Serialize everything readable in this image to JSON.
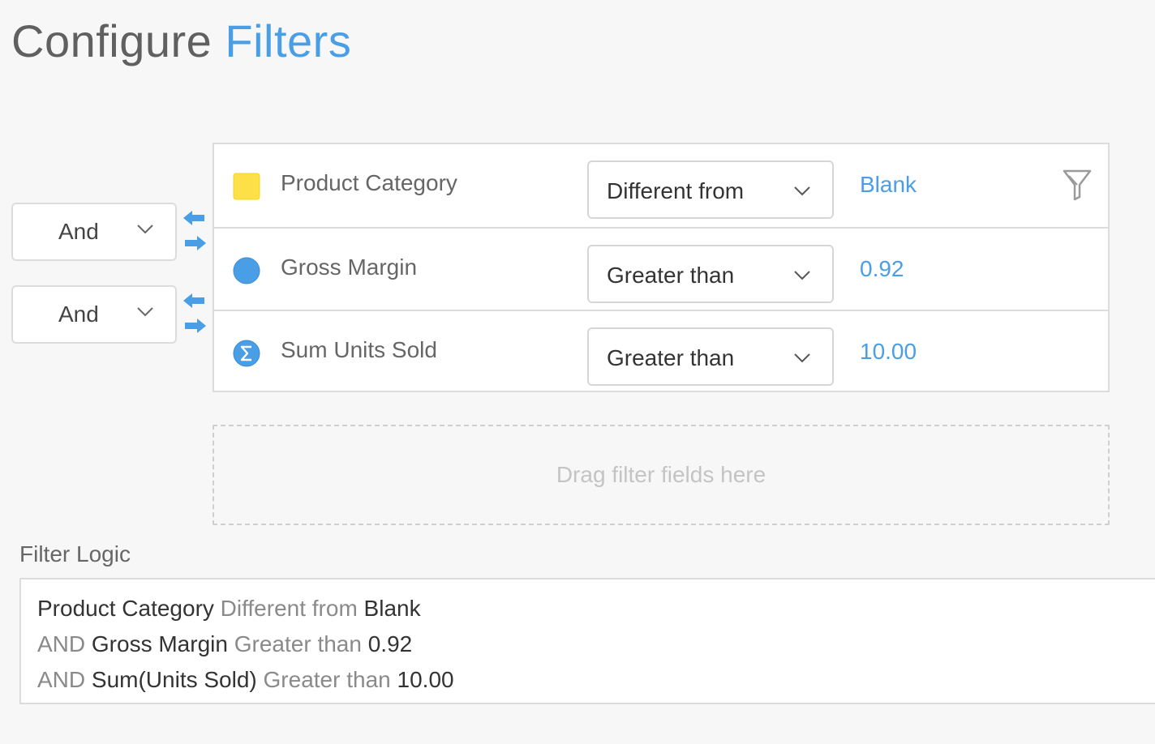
{
  "page": {
    "title_main": "Configure",
    "title_accent": "Filters",
    "accent_color": "#4a9ee6"
  },
  "connectors": [
    {
      "label": "And",
      "icon": "chevron-down-icon"
    },
    {
      "label": "And",
      "icon": "chevron-down-icon"
    }
  ],
  "filters": [
    {
      "field": "Product Category",
      "icon": "dimension-square-icon",
      "icon_color": "#fde047",
      "operator": "Different from",
      "value": "Blank"
    },
    {
      "field": "Gross Margin",
      "icon": "measure-circle-icon",
      "icon_color": "#4a9ee6",
      "operator": "Greater than",
      "value": "0.92"
    },
    {
      "field": "Sum Units Sold",
      "icon": "sigma-circle-icon",
      "icon_color": "#4a9ee6",
      "operator": "Greater than",
      "value": "10.00"
    }
  ],
  "drop_zone": {
    "text": "Drag filter fields here"
  },
  "filter_logic": {
    "label": "Filter Logic",
    "lines": [
      {
        "prefix": "",
        "field": "Product Category",
        "op": "Different from",
        "value": "Blank"
      },
      {
        "prefix": "AND",
        "field": "Gross Margin",
        "op": "Greater than",
        "value": "0.92"
      },
      {
        "prefix": "AND",
        "field": "Sum(Units Sold)",
        "op": "Greater than",
        "value": "10.00"
      }
    ]
  }
}
